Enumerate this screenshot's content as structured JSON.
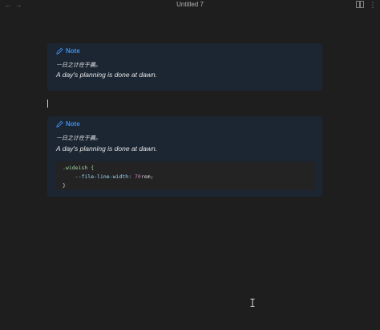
{
  "window": {
    "title": "Untitled 7",
    "back_icon": "arrow-left-icon",
    "forward_icon": "arrow-right-icon",
    "reading_view_icon": "book-open-icon",
    "more_icon": "more-options-icon"
  },
  "callouts": [
    {
      "icon": "pencil-icon",
      "title": "Note",
      "line_cjk": "一日之计在于晨。",
      "line_en": "A day's planning is done at dawn."
    },
    {
      "icon": "pencil-icon",
      "title": "Note",
      "line_cjk": "一日之计在于晨。",
      "line_en": "A day's planning is done at dawn.",
      "code": {
        "selector": ".wideish {",
        "property": "--file-line-width",
        "colon": ": ",
        "value": "70",
        "unit": "rem;",
        "closing": "}"
      }
    }
  ],
  "colors": {
    "background": "#1e1e1e",
    "callout_bg": "#1c2633",
    "accent": "#3b8eea",
    "code_bg": "#232323"
  }
}
